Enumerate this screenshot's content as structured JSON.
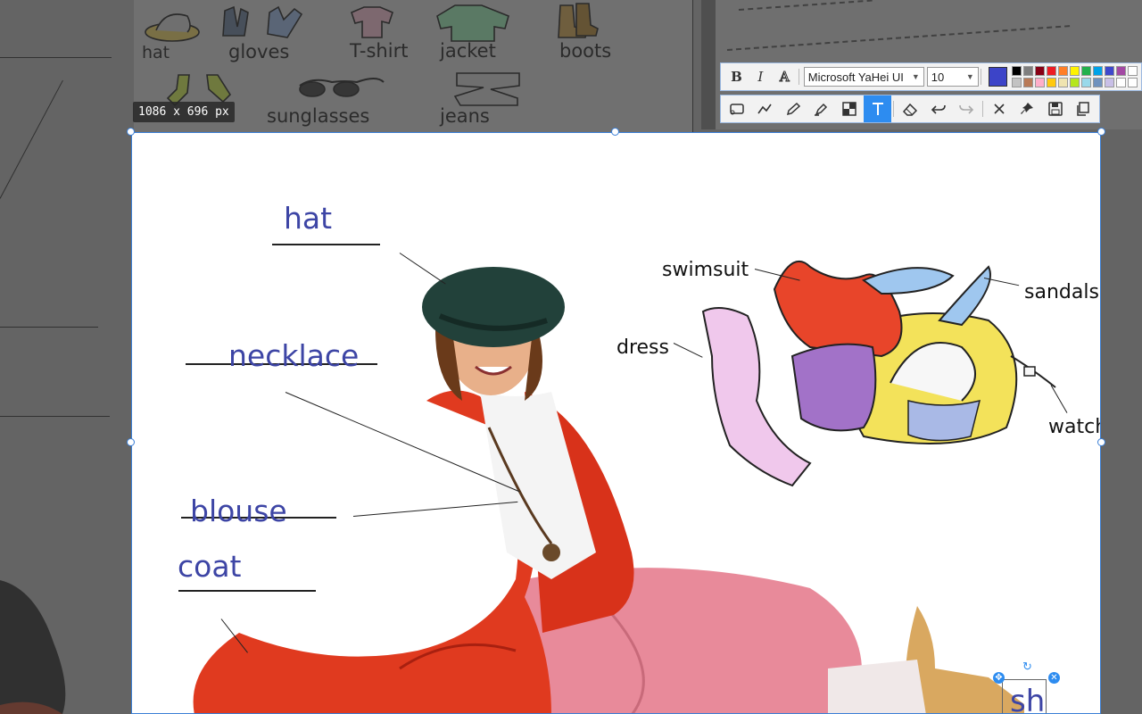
{
  "screenshot_tool": {
    "size_label": "1086 x 696 px",
    "format_bar": {
      "bold_label": "B",
      "italic_label": "I",
      "outline_label": "A",
      "font_family": "Microsoft YaHei UI",
      "font_size": "10",
      "current_color": "#3c44c8",
      "palette": [
        "#000000",
        "#7f7f7f",
        "#880015",
        "#ed1c24",
        "#ff7f27",
        "#fff200",
        "#22b14c",
        "#00a2e8",
        "#3f48cc",
        "#a349a4",
        "#ffffff",
        "#c3c3c3",
        "#b97a57",
        "#ffaec9",
        "#ffc90e",
        "#efe4b0",
        "#b5e61d",
        "#99d9ea",
        "#7092be",
        "#c8bfe7",
        "#ffffff",
        "#ffffff"
      ]
    },
    "tools": [
      "rectangle-icon",
      "polyline-icon",
      "pencil-icon",
      "marker-icon",
      "mosaic-icon",
      "text-icon",
      "eraser-icon",
      "undo-icon",
      "redo-icon",
      "close-icon",
      "pin-icon",
      "save-icon",
      "copy-icon"
    ],
    "active_tool": "text-icon"
  },
  "background_page": {
    "words": [
      "hat",
      "gloves",
      "T-shirt",
      "jacket",
      "boots",
      "sunglasses",
      "jeans"
    ]
  },
  "worksheet": {
    "labels_filled": [
      "hat",
      "necklace",
      "blouse",
      "coat"
    ],
    "labels_printed": [
      "swimsuit",
      "sandals",
      "dress",
      "watch"
    ],
    "typing_text": "sh"
  },
  "colors": {
    "accent": "#2d8cf0",
    "label_blue": "#3d45a5",
    "selection_border": "#3b7fd6"
  }
}
